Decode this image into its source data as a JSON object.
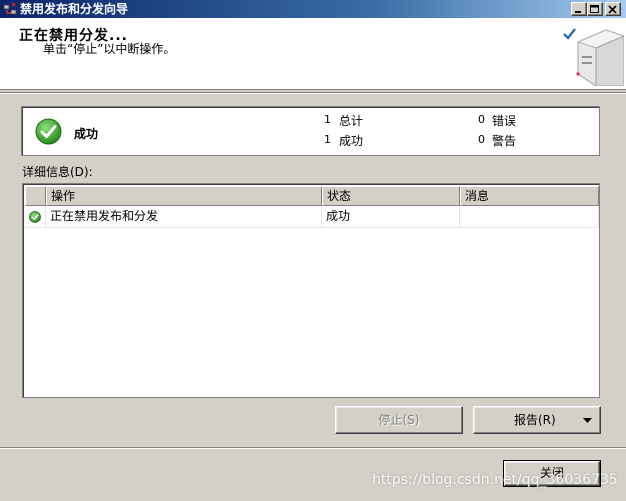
{
  "window": {
    "title": "禁用发布和分发向导",
    "controls": [
      "minimize",
      "maximize",
      "close"
    ]
  },
  "header": {
    "title": "正在禁用分发...",
    "subtitle": "单击“停止”以中断操作。"
  },
  "summary": {
    "status_icon": "success-check-icon",
    "status": "成功",
    "stats": [
      {
        "value": "1",
        "label": "总计"
      },
      {
        "value": "0",
        "label": "错误"
      },
      {
        "value": "1",
        "label": "成功"
      },
      {
        "value": "0",
        "label": "警告"
      }
    ]
  },
  "details": {
    "label": "详细信息(D):",
    "columns": [
      "操作",
      "状态",
      "消息"
    ],
    "rows": [
      {
        "icon": "success-check-icon",
        "action": "正在禁用发布和分发",
        "status": "成功",
        "message": ""
      }
    ]
  },
  "buttons": {
    "stop": "停止(S)",
    "report": "报告(R)",
    "close": "关闭"
  },
  "watermark": "https://blog.csdn.net/qq_36036735",
  "colors": {
    "titlebar_start": "#0a246a",
    "titlebar_end": "#a6caf0",
    "success_green": "#3a9a2a",
    "face": "#d4d0c8"
  }
}
